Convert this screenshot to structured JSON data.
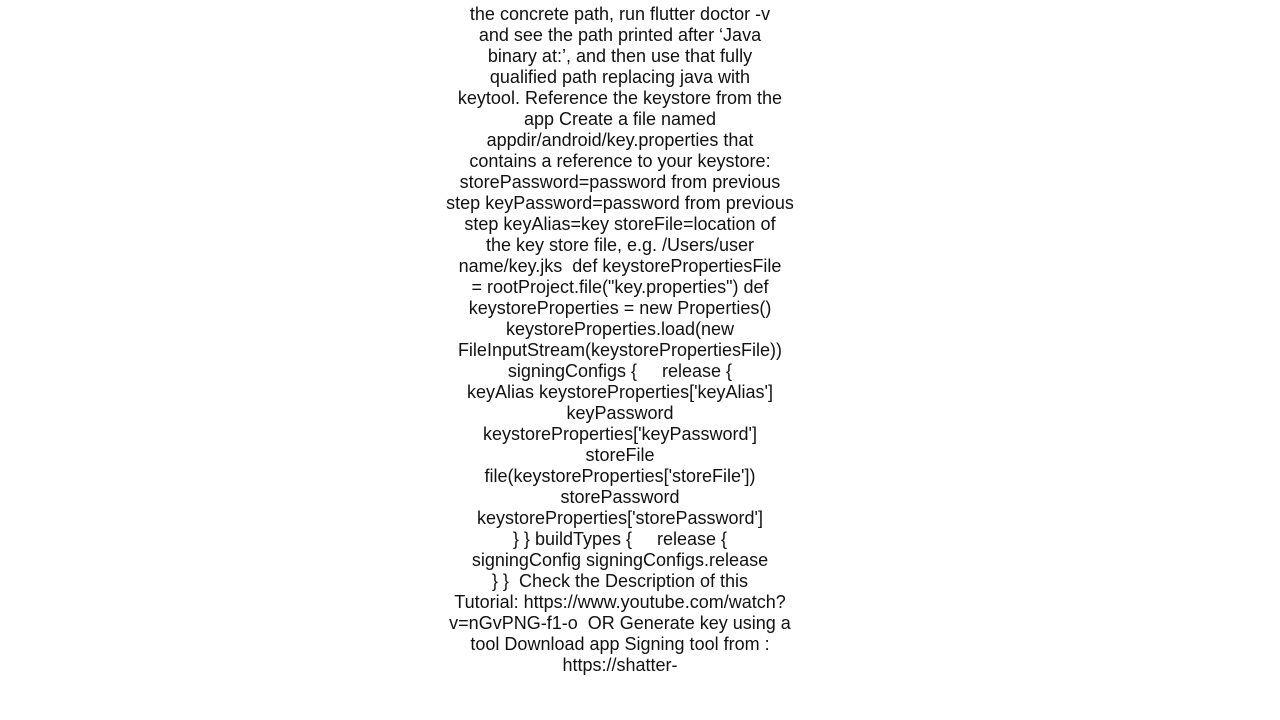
{
  "document": {
    "lines": [
      "",
      "the concrete path, run flutter doctor -v",
      "and see the path printed after ‘Java",
      "binary at:’, and then use that fully",
      "qualified path replacing java with",
      "keytool. Reference the keystore from the",
      "app Create a file named",
      "appdir/android/key.properties that",
      "contains a reference to your keystore:",
      "storePassword=password from previous",
      "step keyPassword=password from previous",
      "step keyAlias=key storeFile=location of",
      "the key store file, e.g. /Users/user",
      "name/key.jks  def keystorePropertiesFile",
      "= rootProject.file(\"key.properties\") def",
      "keystoreProperties = new Properties()",
      "keystoreProperties.load(new",
      "FileInputStream(keystorePropertiesFile))",
      "signingConfigs {     release {",
      "keyAlias keystoreProperties['keyAlias']",
      "keyPassword",
      "keystoreProperties['keyPassword']",
      "storeFile",
      "file(keystoreProperties['storeFile'])",
      "storePassword",
      "keystoreProperties['storePassword']",
      "} } buildTypes {     release {",
      "signingConfig signingConfigs.release",
      "} }  Check the Description of this",
      "Tutorial: https://www.youtube.com/watch?",
      "v=nGvPNG-f1-o  OR Generate key using a",
      "tool Download app Signing tool from :",
      "https://shatter-",
      ""
    ]
  }
}
